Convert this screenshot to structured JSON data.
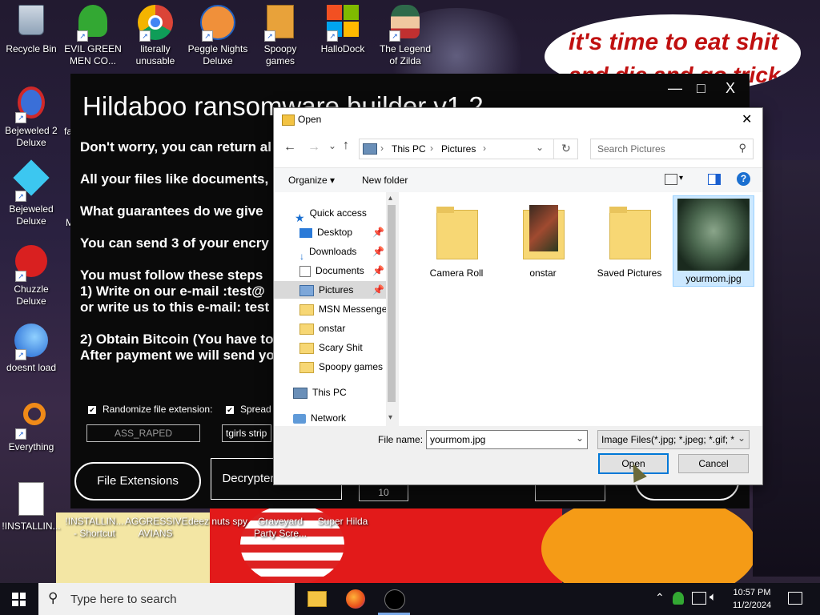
{
  "desktop": {
    "icons": [
      {
        "label": "Recycle Bin"
      },
      {
        "label": "EVIL GREEN MEN CO..."
      },
      {
        "label": "literally unusable"
      },
      {
        "label": "Peggle Nights Deluxe"
      },
      {
        "label": "Spoopy games"
      },
      {
        "label": "HalloDock"
      },
      {
        "label": "The Legend of Zilda"
      },
      {
        "label": "Bejeweled 2 Deluxe"
      },
      {
        "label": "Bejeweled Deluxe"
      },
      {
        "label": "Chuzzle Deluxe"
      },
      {
        "label": "doesnt load"
      },
      {
        "label": "Everything"
      },
      {
        "label": "!INSTALLIN..."
      },
      {
        "label": "!INSTALLIN... - Shortcut"
      },
      {
        "label": "AGGRESSIVE AVIANS"
      },
      {
        "label": "deez nuts spy"
      },
      {
        "label": "Graveyard Party Scre..."
      },
      {
        "label": "Super Hilda"
      }
    ],
    "partial_labels": {
      "fa": "fa",
      "m": "M"
    },
    "speech_bubble": {
      "line1": "it's time to eat shit",
      "line2": "and die and go trick"
    }
  },
  "ransom_window": {
    "title": "Hildaboo ransomware builder v1.2",
    "minimize_glyph": "—",
    "maximize_glyph": "□",
    "close_glyph": "X",
    "lines": [
      "Don't worry, you can return al",
      "All your files like documents, ",
      "What guarantees do we give ",
      "You can send 3 of your encry",
      "You must follow these steps ",
      "1) Write on our e-mail :test@",
      "or write us to this e-mail: test",
      "2) Obtain Bitcoin (You have to",
      "After payment we will send yo"
    ],
    "checkbox1": "Randomize file extension:",
    "checkbox2": "Spread",
    "input1_value": "ASS_RAPED",
    "input2_value": "tgirls strip",
    "button_extensions": "File Extensions",
    "button_decrypter": "Decrypter & Options",
    "field_partial": "10"
  },
  "open_dialog": {
    "title": "Open",
    "close_glyph": "✕",
    "breadcrumb": [
      "This PC",
      "Pictures"
    ],
    "search_placeholder": "Search Pictures",
    "organize": "Organize ▾",
    "new_folder": "New folder",
    "nav_items": [
      "Quick access",
      "Desktop",
      "Downloads",
      "Documents",
      "Pictures",
      "MSN Messenger",
      "onstar",
      "Scary Shit",
      "Spoopy games",
      "This PC",
      "Network"
    ],
    "files": [
      {
        "name": "Camera Roll",
        "kind": "folder"
      },
      {
        "name": "onstar",
        "kind": "folder"
      },
      {
        "name": "Saved Pictures",
        "kind": "folder"
      },
      {
        "name": "yourmom.jpg",
        "kind": "image",
        "selected": true
      }
    ],
    "file_name_label": "File name:",
    "file_name_value": "yourmom.jpg",
    "file_type_value": "Image Files(*.jpg; *.jpeg; *.gif; *",
    "open_button": "Open",
    "cancel_button": "Cancel"
  },
  "taskbar": {
    "search_placeholder": "Type here to search",
    "time": "10:57 PM",
    "date": "11/2/2024"
  },
  "colors": {
    "accent": "#0078d7",
    "selection": "#cce8ff",
    "folder": "#f7d774",
    "taskbar": "#101018"
  }
}
